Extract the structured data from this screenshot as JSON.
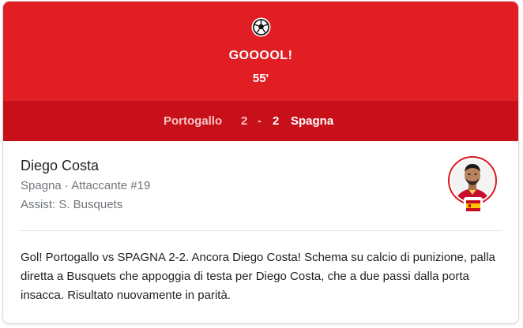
{
  "event": {
    "icon": "soccer-ball-icon",
    "title": "GOOOOL!",
    "minute": "55'"
  },
  "score": {
    "home_team": "Portogallo",
    "home_score": "2",
    "separator": "-",
    "away_score": "2",
    "away_team": "Spagna"
  },
  "player": {
    "name": "Diego Costa",
    "meta": "Spagna · Attaccante #19",
    "assist": "Assist: S. Busquets",
    "flag_icon": "spain-flag-icon"
  },
  "description": "Gol! Portogallo vs SPAGNA 2-2. Ancora Diego Costa! Schema su calcio di punizione, palla diretta a Busquets che appoggia di testa per Diego Costa, che a due passi dalla porta insacca. Risultato nuovamente in parità.",
  "colors": {
    "header_red": "#e01e23",
    "scorebar_red": "#c8101a",
    "secondary_text": "#70757a"
  }
}
